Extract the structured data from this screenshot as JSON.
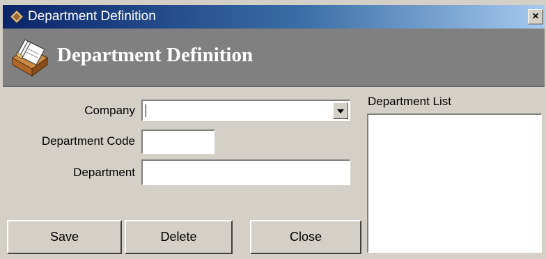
{
  "window": {
    "title": "Department Definition",
    "close_label": "×"
  },
  "banner": {
    "title": "Department Definition",
    "icon": "card-file-box-icon"
  },
  "form": {
    "company_label": "Company",
    "company_value": "",
    "department_code_label": "Department Code",
    "department_code_value": "",
    "department_label": "Department",
    "department_value": ""
  },
  "list": {
    "label": "Department List",
    "items": []
  },
  "buttons": {
    "save": "Save",
    "delete": "Delete",
    "close": "Close"
  },
  "colors": {
    "title_bar_start": "#0a246a",
    "title_bar_end": "#a6caf0",
    "banner": "#808080",
    "face": "#d4d0c8"
  }
}
